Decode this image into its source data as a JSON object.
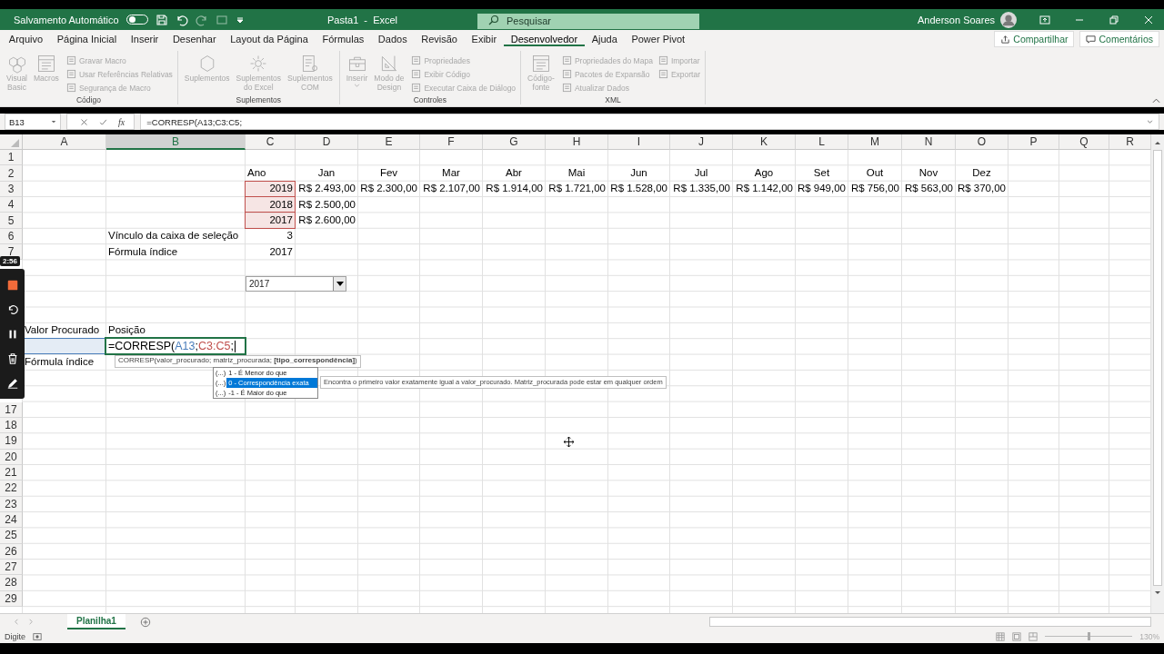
{
  "title_bar": {
    "autosave_label": "Salvamento Automático",
    "autosave_on": false,
    "title": "Pasta1  -  Excel",
    "search_placeholder": "Pesquisar",
    "user_name": "Anderson Soares"
  },
  "ribbon_tabs": [
    {
      "label": "Arquivo",
      "selected": false
    },
    {
      "label": "Página Inicial",
      "selected": false
    },
    {
      "label": "Inserir",
      "selected": false
    },
    {
      "label": "Desenhar",
      "selected": false
    },
    {
      "label": "Layout da Página",
      "selected": false
    },
    {
      "label": "Fórmulas",
      "selected": false
    },
    {
      "label": "Dados",
      "selected": false
    },
    {
      "label": "Revisão",
      "selected": false
    },
    {
      "label": "Exibir",
      "selected": false
    },
    {
      "label": "Desenvolvedor",
      "selected": true
    },
    {
      "label": "Ajuda",
      "selected": false
    },
    {
      "label": "Power Pivot",
      "selected": false
    }
  ],
  "share_button": "Compartilhar",
  "comments_button": "Comentários",
  "ribbon_groups": [
    {
      "title": "Código",
      "large": [
        {
          "lines": [
            "Visual",
            "Basic"
          ],
          "disabled": true,
          "dropdown": false
        },
        {
          "lines": [
            "Macros"
          ],
          "disabled": true,
          "dropdown": false
        }
      ],
      "small": [
        {
          "label": "Gravar Macro",
          "disabled": true
        },
        {
          "label": "Usar Referências Relativas",
          "disabled": true
        },
        {
          "label": "Segurança de Macro",
          "disabled": true
        }
      ]
    },
    {
      "title": "Suplementos",
      "large": [
        {
          "lines": [
            "Suplementos"
          ],
          "disabled": true,
          "dropdown": false
        },
        {
          "lines": [
            "Suplementos",
            "do Excel"
          ],
          "disabled": true,
          "dropdown": false
        },
        {
          "lines": [
            "Suplementos",
            "COM"
          ],
          "disabled": true,
          "dropdown": false
        }
      ]
    },
    {
      "title": "Controles",
      "large": [
        {
          "lines": [
            "Inserir"
          ],
          "disabled": true,
          "dropdown": true
        },
        {
          "lines": [
            "Modo de",
            "Design"
          ],
          "disabled": true,
          "dropdown": false
        }
      ],
      "small": [
        {
          "label": "Propriedades",
          "disabled": true
        },
        {
          "label": "Exibir Código",
          "disabled": true
        },
        {
          "label": "Executar Caixa de Diálogo",
          "disabled": true
        }
      ]
    },
    {
      "title": "XML",
      "large": [
        {
          "lines": [
            "Código-",
            "fonte"
          ],
          "disabled": true,
          "dropdown": false
        }
      ],
      "small": [
        {
          "label": "Propriedades do Mapa",
          "disabled": true
        },
        {
          "label": "Pacotes de Expansão",
          "disabled": true
        },
        {
          "label": "Atualizar Dados",
          "disabled": true
        },
        {
          "label": "Importar",
          "disabled": true
        },
        {
          "label": "Exportar",
          "disabled": true
        }
      ]
    }
  ],
  "formula_bar": {
    "name_box": "B13",
    "function_label": "fx",
    "formula": "=CORRESP(A13;C3:C5;"
  },
  "columns": [
    {
      "letter": "A",
      "selected": false
    },
    {
      "letter": "B",
      "selected": true
    },
    {
      "letter": "C",
      "selected": false
    },
    {
      "letter": "D",
      "selected": false
    },
    {
      "letter": "E",
      "selected": false
    },
    {
      "letter": "F",
      "selected": false
    },
    {
      "letter": "G",
      "selected": false
    },
    {
      "letter": "H",
      "selected": false
    },
    {
      "letter": "I",
      "selected": false
    },
    {
      "letter": "J",
      "selected": false
    },
    {
      "letter": "K",
      "selected": false
    },
    {
      "letter": "L",
      "selected": false
    },
    {
      "letter": "M",
      "selected": false
    },
    {
      "letter": "N",
      "selected": false
    },
    {
      "letter": "O",
      "selected": false
    },
    {
      "letter": "P",
      "selected": false
    },
    {
      "letter": "Q",
      "selected": false
    },
    {
      "letter": "R",
      "selected": false
    }
  ],
  "rows": [
    {
      "number": "1"
    },
    {
      "number": "2",
      "cells": {
        "C": {
          "text": "Ano",
          "kind": "text"
        },
        "D": {
          "text": "Jan",
          "kind": "heading"
        },
        "E": {
          "text": "Fev",
          "kind": "heading"
        },
        "F": {
          "text": "Mar",
          "kind": "heading"
        },
        "G": {
          "text": "Abr",
          "kind": "heading"
        },
        "H": {
          "text": "Mai",
          "kind": "heading"
        },
        "I": {
          "text": "Jun",
          "kind": "heading"
        },
        "J": {
          "text": "Jul",
          "kind": "heading"
        },
        "K": {
          "text": "Ago",
          "kind": "heading"
        },
        "L": {
          "text": "Set",
          "kind": "heading"
        },
        "M": {
          "text": "Out",
          "kind": "heading"
        },
        "N": {
          "text": "Nov",
          "kind": "heading"
        },
        "O": {
          "text": "Dez",
          "kind": "heading"
        }
      }
    },
    {
      "number": "3",
      "cells": {
        "C": {
          "text": "2019",
          "kind": "number",
          "color": "#c0504d"
        },
        "D": {
          "text": "R$ 2.493,00",
          "kind": "number"
        },
        "E": {
          "text": "R$ 2.300,00",
          "kind": "number"
        },
        "F": {
          "text": "R$ 2.107,00",
          "kind": "number"
        },
        "G": {
          "text": "R$ 1.914,00",
          "kind": "number"
        },
        "H": {
          "text": "R$ 1.721,00",
          "kind": "number"
        },
        "I": {
          "text": "R$ 1.528,00",
          "kind": "number"
        },
        "J": {
          "text": "R$ 1.335,00",
          "kind": "number"
        },
        "K": {
          "text": "R$ 1.142,00",
          "kind": "number"
        },
        "L": {
          "text": "R$ 949,00",
          "kind": "number"
        },
        "M": {
          "text": "R$ 756,00",
          "kind": "number"
        },
        "N": {
          "text": "R$ 563,00",
          "kind": "number"
        },
        "O": {
          "text": "R$ 370,00",
          "kind": "number"
        }
      }
    },
    {
      "number": "4",
      "cells": {
        "C": {
          "text": "2018",
          "kind": "number",
          "color": "#c0504d"
        },
        "D": {
          "text": "R$ 2.500,00",
          "kind": "number"
        }
      }
    },
    {
      "number": "5",
      "cells": {
        "C": {
          "text": "2017",
          "kind": "number",
          "color": "#c0504d"
        },
        "D": {
          "text": "R$ 2.600,00",
          "kind": "number"
        }
      }
    },
    {
      "number": "6",
      "cells": {
        "B": {
          "text": "Vínculo da caixa de seleção",
          "kind": "text"
        },
        "C": {
          "text": "3",
          "kind": "number"
        }
      }
    },
    {
      "number": "7",
      "cells": {
        "B": {
          "text": "Fórmula índice",
          "kind": "text"
        },
        "C": {
          "text": "2017",
          "kind": "number"
        }
      }
    },
    {},
    {},
    {},
    {},
    {
      "cells": {
        "A": {
          "text": "Valor Procurado",
          "kind": "text"
        },
        "B": {
          "text": "Posição",
          "kind": "text"
        }
      }
    },
    {
      "cells": {
        "A": {
          "color": "#4a7ebb"
        },
        "B": {
          "editing": true,
          "segments": [
            {
              "text": "=CORRESP("
            },
            {
              "text": "A13",
              "color": "#4a7ebb"
            },
            {
              "text": ";"
            },
            {
              "text": "C3:C5",
              "color": "#c0504d"
            },
            {
              "text": ";"
            }
          ]
        }
      }
    },
    {
      "cells": {
        "A": {
          "text": "Fórmula índice",
          "kind": "text"
        }
      }
    },
    {},
    {},
    {
      "number": "17"
    },
    {
      "number": "18"
    },
    {
      "number": "19"
    },
    {
      "number": "20"
    },
    {
      "number": "21"
    },
    {
      "number": "22"
    },
    {
      "number": "23"
    },
    {
      "number": "24"
    },
    {
      "number": "25"
    },
    {
      "number": "26"
    },
    {
      "number": "27"
    },
    {
      "number": "28"
    },
    {
      "number": "29"
    }
  ],
  "combo_box": {
    "value": "2017"
  },
  "function_tooltip": "CORRESP(valor_procurado; matriz_procurada; **[tipo_correspondência]**)",
  "autocomplete": [
    {
      "glyph": "(...)",
      "label": "1 - É Menor do que",
      "selected": false
    },
    {
      "glyph": "(...)",
      "label": "0 - Correspondência exata",
      "selected": true
    },
    {
      "glyph": "(...)",
      "label": "-1 - É Maior do que",
      "selected": false
    }
  ],
  "autocomplete_description": "Encontra o primeiro valor exatamente igual a valor_procurado. Matriz_procurada pode estar em qualquer ordem",
  "sheet_tabs": [
    {
      "label": "Planilha1",
      "selected": true
    }
  ],
  "status_bar": {
    "mode": "Digite",
    "zoom": "130%",
    "zoom_slider": {
      "level": 0.5
    }
  },
  "recorder": {
    "timer": "2:56"
  }
}
